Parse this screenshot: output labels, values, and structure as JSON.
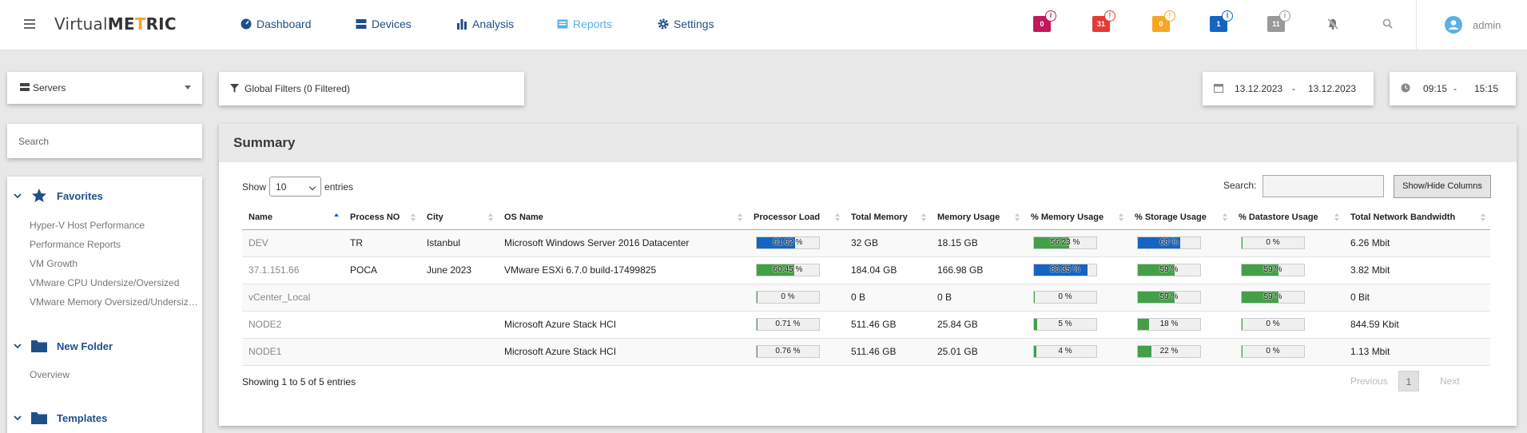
{
  "app": {
    "logo_prefix": "Virtual",
    "logo_bold1": "ME",
    "logo_accent": "T",
    "logo_bold2": "RIC",
    "user": "admin"
  },
  "nav": {
    "dashboard": "Dashboard",
    "devices": "Devices",
    "analysis": "Analysis",
    "reports": "Reports",
    "settings": "Settings"
  },
  "alerts": [
    {
      "count": "0",
      "color": "#c2185b"
    },
    {
      "count": "31",
      "color": "#e53935"
    },
    {
      "count": "0",
      "color": "#f5a623"
    },
    {
      "count": "1",
      "color": "#1565c0"
    },
    {
      "count": "11",
      "color": "#999999"
    }
  ],
  "toolbar": {
    "server_select": "Servers",
    "global_filters": "Global Filters (0 Filtered)",
    "date_from": "13.12.2023",
    "date_to": "13.12.2023",
    "time_from": "09:15",
    "time_to": "15:15",
    "dash": "-"
  },
  "sidebar": {
    "search_placeholder": "Search",
    "favorites": {
      "label": "Favorites",
      "items": [
        "Hyper-V Host Performance",
        "Performance Reports",
        "VM Growth",
        "VMware CPU Undersize/Oversized",
        "VMware Memory Oversized/Undersized"
      ]
    },
    "new_folder": {
      "label": "New Folder",
      "items": [
        "Overview"
      ]
    },
    "templates": {
      "label": "Templates"
    }
  },
  "summary": {
    "title": "Summary",
    "show_label": "Show",
    "page_size": "10",
    "entries_label": "entries",
    "search_label": "Search:",
    "showhide_label": "Show/Hide Columns",
    "columns": [
      "Name",
      "Process NO",
      "City",
      "OS Name",
      "Processor Load",
      "Total Memory",
      "Memory Usage",
      "% Memory Usage",
      "% Storage Usage",
      "% Datastore Usage",
      "Total Network Bandwidth"
    ],
    "rows": [
      {
        "name": "DEV",
        "process_no": "TR",
        "city": "Istanbul",
        "os": "Microsoft Windows Server 2016 Datacenter",
        "cpu": "61.62 %",
        "cpu_pct": 61.62,
        "cpu_color": "#1565c0",
        "total_mem": "32 GB",
        "mem_usage": "18.15 GB",
        "mem_pct_txt": "56.23 %",
        "mem_pct": 56.23,
        "mem_color": "#43a047",
        "stor_txt": "68 %",
        "stor_pct": 68,
        "stor_color": "#1565c0",
        "ds_txt": "0 %",
        "ds_pct": 0,
        "ds_color": "#43a047",
        "bw": "6.26 Mbit"
      },
      {
        "name": "37.1.151.66",
        "process_no": "POCA",
        "city": "June 2023",
        "os": "VMware ESXi 6.7.0 build-17499825",
        "cpu": "60.45 %",
        "cpu_pct": 60.45,
        "cpu_color": "#43a047",
        "total_mem": "184.04 GB",
        "mem_usage": "166.98 GB",
        "mem_pct_txt": "86.35 %",
        "mem_pct": 86.35,
        "mem_color": "#1565c0",
        "stor_txt": "59 %",
        "stor_pct": 59,
        "stor_color": "#43a047",
        "ds_txt": "59 %",
        "ds_pct": 59,
        "ds_color": "#43a047",
        "bw": "3.82 Mbit"
      },
      {
        "name": "vCenter_Local",
        "process_no": "",
        "city": "",
        "os": "",
        "cpu": "0 %",
        "cpu_pct": 0,
        "cpu_color": "#43a047",
        "total_mem": "0 B",
        "mem_usage": "0 B",
        "mem_pct_txt": "0 %",
        "mem_pct": 0,
        "mem_color": "#43a047",
        "stor_txt": "59 %",
        "stor_pct": 59,
        "stor_color": "#43a047",
        "ds_txt": "59 %",
        "ds_pct": 59,
        "ds_color": "#43a047",
        "bw": "0 Bit"
      },
      {
        "name": "NODE2",
        "process_no": "",
        "city": "",
        "os": "Microsoft Azure Stack HCI",
        "cpu": "0.71 %",
        "cpu_pct": 0.71,
        "cpu_color": "#43a047",
        "total_mem": "511.46 GB",
        "mem_usage": "25.84 GB",
        "mem_pct_txt": "5 %",
        "mem_pct": 5,
        "mem_color": "#43a047",
        "stor_txt": "18 %",
        "stor_pct": 18,
        "stor_color": "#43a047",
        "ds_txt": "0 %",
        "ds_pct": 0,
        "ds_color": "#43a047",
        "bw": "844.59 Kbit"
      },
      {
        "name": "NODE1",
        "process_no": "",
        "city": "",
        "os": "Microsoft Azure Stack HCI",
        "cpu": "0.76 %",
        "cpu_pct": 0.76,
        "cpu_color": "#43a047",
        "total_mem": "511.46 GB",
        "mem_usage": "25.01 GB",
        "mem_pct_txt": "4 %",
        "mem_pct": 4,
        "mem_color": "#43a047",
        "stor_txt": "22 %",
        "stor_pct": 22,
        "stor_color": "#43a047",
        "ds_txt": "0 %",
        "ds_pct": 0,
        "ds_color": "#43a047",
        "bw": "1.13 Mbit"
      }
    ],
    "info": "Showing 1 to 5 of 5 entries",
    "prev": "Previous",
    "page": "1",
    "next": "Next"
  }
}
